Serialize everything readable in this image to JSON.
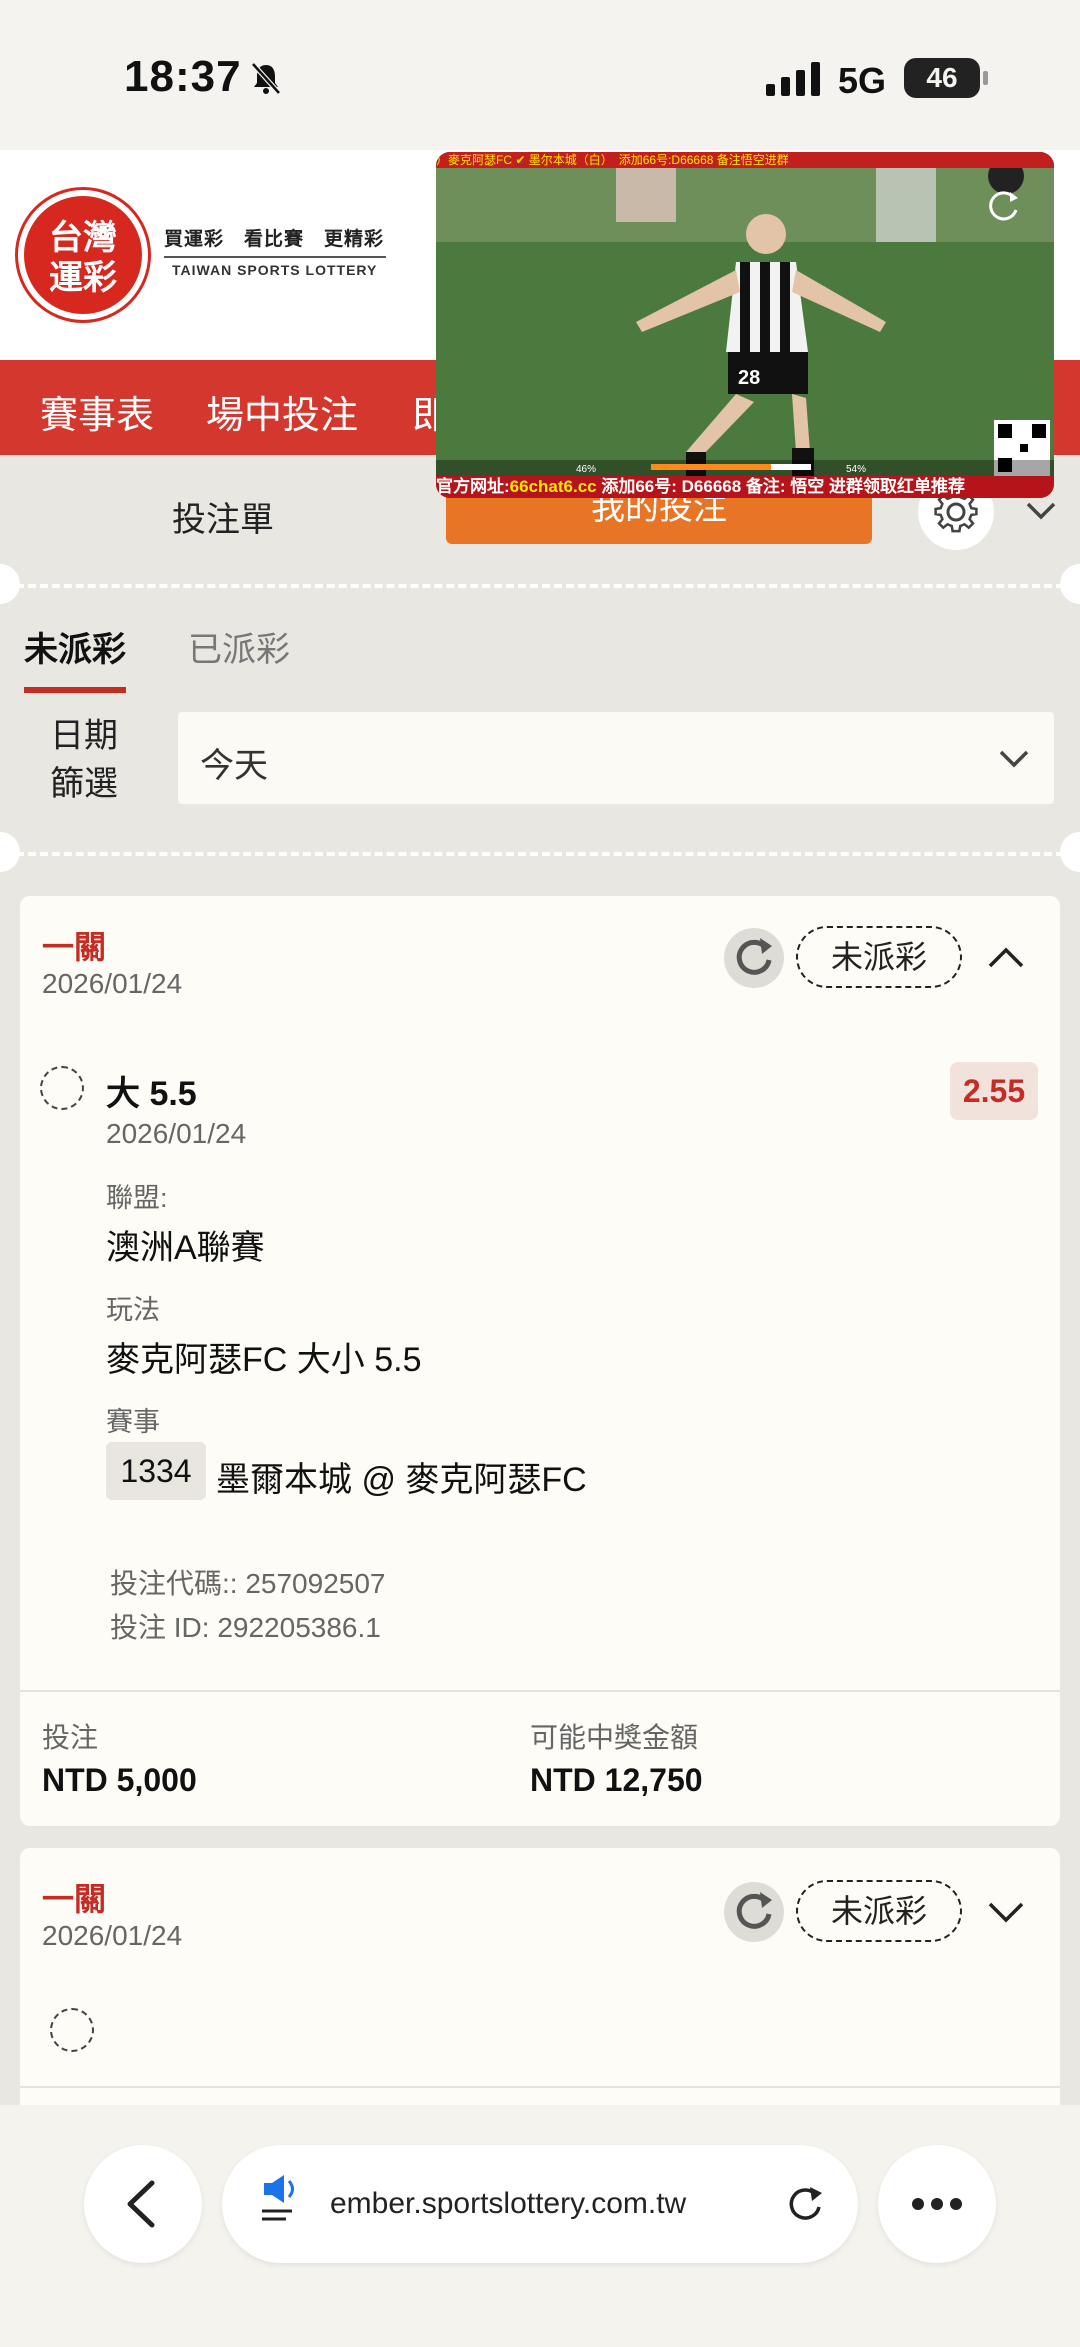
{
  "status_bar": {
    "time": "18:37",
    "network": "5G",
    "battery": "46"
  },
  "header": {
    "logo_text_line1": "台灣",
    "logo_text_line2": "運彩",
    "slogan": "買運彩　看比賽　更精彩",
    "english_name": "TAIWAN SPORTS LOTTERY"
  },
  "nav": {
    "items": [
      "賽事表",
      "場中投注",
      "即"
    ]
  },
  "video": {
    "top_banner": "）麥克阿瑟FC ✔ 墨尔本城（白）　添加66号:D66668 备注悟空进群",
    "bottom_banner_pre": "官方网址:",
    "bottom_banner_url": "66chat6.cc",
    "bottom_banner_post": " 添加66号: D66668 备注: 悟空 进群领取红单推荐",
    "player_number": "28",
    "stats_left": "46%",
    "stats_right": "54%"
  },
  "ticket": {
    "title": "投注單",
    "my_bets_button": "我的投注",
    "tabs": [
      "未派彩",
      "已派彩"
    ],
    "active_tab": 0,
    "date_filter_label_1": "日期",
    "date_filter_label_2": "篩選",
    "date_filter_value": "今天"
  },
  "bets": [
    {
      "type": "一關",
      "date": "2026/01/24",
      "status": "未派彩",
      "expanded": true,
      "selection": "大 5.5",
      "selection_date": "2026/01/24",
      "odds": "2.55",
      "league_label": "聯盟:",
      "league": "澳洲A聯賽",
      "market_label": "玩法",
      "market": "麥克阿瑟FC 大小 5.5",
      "match_label": "賽事",
      "match_id": "1334",
      "match": "墨爾本城 @ 麥克阿瑟FC",
      "bet_code": "投注代碼:: 257092507",
      "bet_id": "投注 ID: 292205386.1",
      "stake_label": "投注",
      "stake": "NTD 5,000",
      "payout_label": "可能中獎金額",
      "payout": "NTD 12,750"
    },
    {
      "type": "一關",
      "date": "2026/01/24",
      "status": "未派彩",
      "expanded": false
    }
  ],
  "browser": {
    "url": "member.sportslottery.com.tw",
    "url_visible": "ember.sportslottery.com.tw"
  },
  "colors": {
    "brand_red": "#d3372e",
    "accent_orange": "#e87525",
    "odds_red": "#c32d24"
  }
}
